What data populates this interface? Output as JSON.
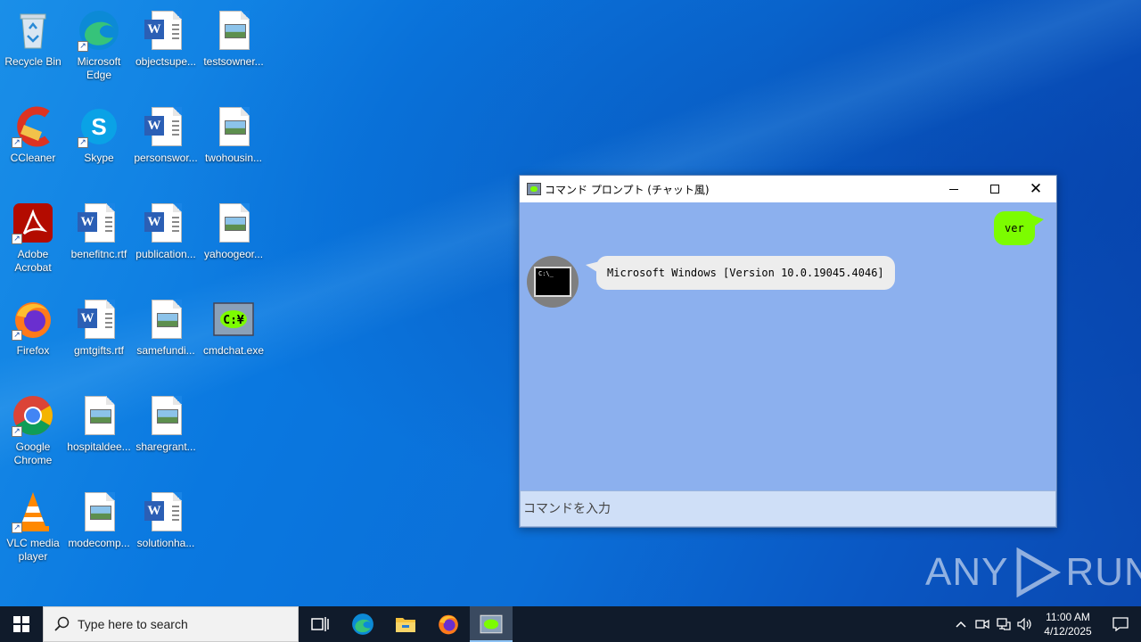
{
  "desktop": {
    "icons": [
      {
        "label": "Recycle Bin"
      },
      {
        "label": "Microsoft Edge"
      },
      {
        "label": "objectsupe..."
      },
      {
        "label": "testsowner..."
      },
      {
        "label": "CCleaner"
      },
      {
        "label": "Skype"
      },
      {
        "label": "personswor..."
      },
      {
        "label": "twohousin..."
      },
      {
        "label": "Adobe Acrobat"
      },
      {
        "label": "benefitnc.rtf"
      },
      {
        "label": "publication..."
      },
      {
        "label": "yahoogeor..."
      },
      {
        "label": "Firefox"
      },
      {
        "label": "gmtgifts.rtf"
      },
      {
        "label": "samefundi..."
      },
      {
        "label": "cmdchat.exe"
      },
      {
        "label": "Google Chrome"
      },
      {
        "label": "hospitaldee..."
      },
      {
        "label": "sharegrant..."
      },
      {
        "label": "VLC media player"
      },
      {
        "label": "modecomp..."
      },
      {
        "label": "solutionha..."
      }
    ]
  },
  "window": {
    "title": "コマンド プロンプト (チャット風)",
    "chat": {
      "user_message": "ver",
      "bot_message": "Microsoft Windows [Version 10.0.19045.4046]",
      "avatar_text": "C:\\_"
    },
    "input_placeholder": "コマンドを入力",
    "colors": {
      "chat_bg": "#8cb0ee",
      "user_bubble": "#7cfc00",
      "bot_bubble": "#ededed"
    }
  },
  "watermark": {
    "left": "ANY",
    "right": "RUN"
  },
  "taskbar": {
    "search_placeholder": "Type here to search",
    "time": "11:00 AM",
    "date": "4/12/2025"
  }
}
